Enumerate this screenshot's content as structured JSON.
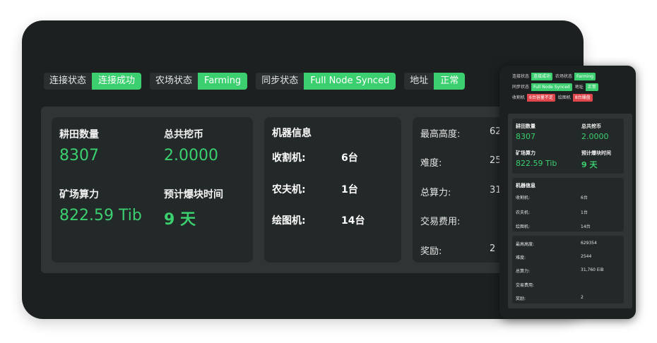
{
  "status": [
    {
      "key": "连接状态",
      "value": "连接成功"
    },
    {
      "key": "农场状态",
      "value": "Farming"
    },
    {
      "key": "同步状态",
      "value": "Full Node Synced"
    },
    {
      "key": "地址",
      "value": "正常"
    }
  ],
  "stats": {
    "plots_label": "耕田数量",
    "plots_value": "8307",
    "mined_label": "总共挖币",
    "mined_value": "2.0000",
    "power_label": "矿场算力",
    "power_value": "822.59 Tib",
    "eta_label": "预计爆块时间",
    "eta_value": "9 天"
  },
  "machines": {
    "title": "机器信息",
    "rows": [
      {
        "key": "收割机:",
        "value": "6台"
      },
      {
        "key": "农夫机:",
        "value": "1台"
      },
      {
        "key": "绘图机:",
        "value": "14台"
      }
    ]
  },
  "chain": {
    "rows": [
      {
        "key": "最高高度:",
        "value": "62"
      },
      {
        "key": "难度:",
        "value": "25"
      },
      {
        "key": "总算力:",
        "value": "31"
      },
      {
        "key": "交易费用:",
        "value": ""
      },
      {
        "key": "奖励:",
        "value": "2"
      }
    ]
  },
  "mobile": {
    "status_line1": [
      {
        "key": "连接状态",
        "value": "连接成功",
        "color": "#3bcf6f"
      },
      {
        "key": "农场状态",
        "value": "Farming",
        "color": "#3bcf6f"
      }
    ],
    "status_line2": [
      {
        "key": "同步状态",
        "value": "Full Node Synced",
        "color": "#3bcf6f"
      },
      {
        "key": "地址",
        "value": "正常",
        "color": "#3bcf6f"
      }
    ],
    "status_line3": [
      {
        "key": "收割机",
        "value": "6台容量不足",
        "color": "#e0474c"
      },
      {
        "key": "绘图机",
        "value": "8台爆盘",
        "color": "#e0474c"
      }
    ],
    "stats": {
      "plots_label": "耕田数量",
      "plots_value": "8307",
      "mined_label": "总共挖币",
      "mined_value": "2.0000",
      "power_label": "矿场算力",
      "power_value": "822.59 Tib",
      "eta_label": "预计爆块时间",
      "eta_value": "9 天"
    },
    "machines": {
      "title": "机器信息",
      "rows": [
        {
          "key": "收割机:",
          "value": "6台"
        },
        {
          "key": "农夫机:",
          "value": "1台"
        },
        {
          "key": "绘图机:",
          "value": "14台"
        }
      ]
    },
    "chain": {
      "rows": [
        {
          "key": "最高高度:",
          "value": "629354"
        },
        {
          "key": "难度:",
          "value": "2544"
        },
        {
          "key": "总算力:",
          "value": "31,760 EiB"
        },
        {
          "key": "交易费用:",
          "value": ""
        },
        {
          "key": "奖励:",
          "value": "2"
        }
      ]
    }
  },
  "colors": {
    "accent": "#3bcf6f",
    "danger": "#e0474c",
    "panel": "#1c2020",
    "card": "#232828"
  }
}
